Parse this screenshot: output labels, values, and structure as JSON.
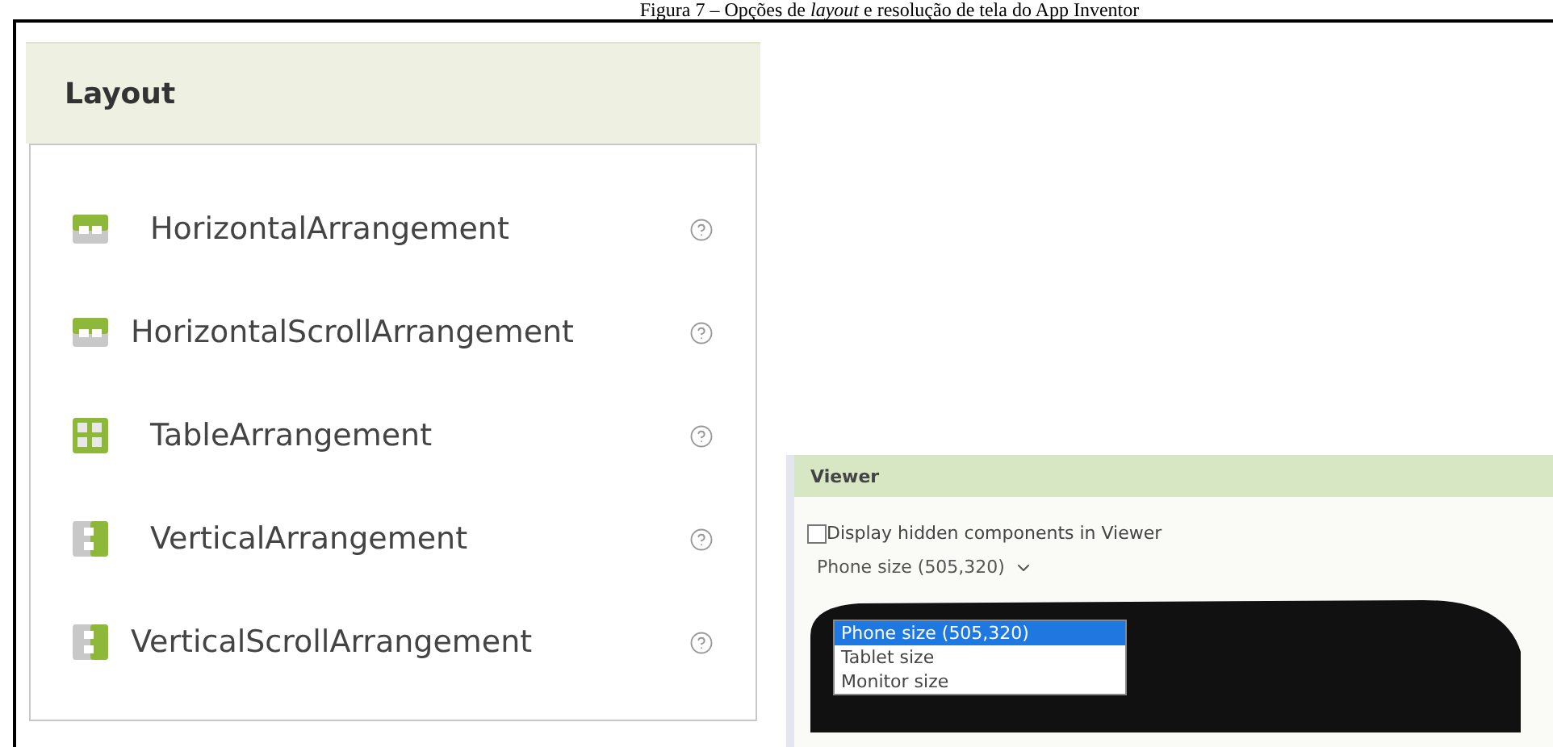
{
  "caption": "Figura 7 – Opções de *layout* e resolução de tela do App Inventor",
  "palette": {
    "title": "Layout",
    "items": [
      {
        "label": "HorizontalArrangement",
        "kind": "horizontal"
      },
      {
        "label": "HorizontalScrollArrangement",
        "kind": "horizontal"
      },
      {
        "label": "TableArrangement",
        "kind": "table"
      },
      {
        "label": "VerticalArrangement",
        "kind": "vertical"
      },
      {
        "label": "VerticalScrollArrangement",
        "kind": "vertical"
      }
    ]
  },
  "viewer": {
    "title": "Viewer",
    "checkbox": {
      "label": "Display hidden components in Viewer",
      "checked": false
    },
    "select": {
      "value": "Phone size (505,320)"
    },
    "options": [
      {
        "label": "Phone size (505,320)",
        "selected": true
      },
      {
        "label": "Tablet size",
        "selected": false
      },
      {
        "label": "Monitor size",
        "selected": false
      }
    ]
  }
}
